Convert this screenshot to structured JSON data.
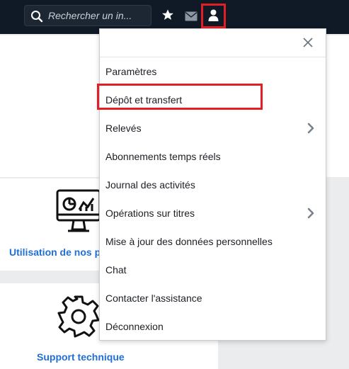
{
  "topbar": {
    "search": {
      "placeholder": "Rechercher un in..."
    },
    "icons": [
      "search-icon",
      "star-icon",
      "mail-icon",
      "user-icon"
    ]
  },
  "menu": {
    "close_icon": "close-icon",
    "items": [
      {
        "label": "Paramètres"
      },
      {
        "label": "Dépôt et transfert"
      },
      {
        "label": "Relevés",
        "submenu": true
      },
      {
        "label": "Abonnements temps réels"
      },
      {
        "label": "Journal des activités"
      },
      {
        "label": "Opérations sur titres",
        "submenu": true
      },
      {
        "label": "Mise à jour des données personnelles"
      },
      {
        "label": "Chat"
      },
      {
        "label": "Contacter l'assistance"
      },
      {
        "label": "Déconnexion"
      }
    ]
  },
  "cards": {
    "usage_link": "Utilisation de nos p",
    "support_link": "Support technique"
  },
  "colors": {
    "topbar_bg": "#0f1a26",
    "highlight": "#e31e24",
    "link": "#1f6fd6"
  }
}
